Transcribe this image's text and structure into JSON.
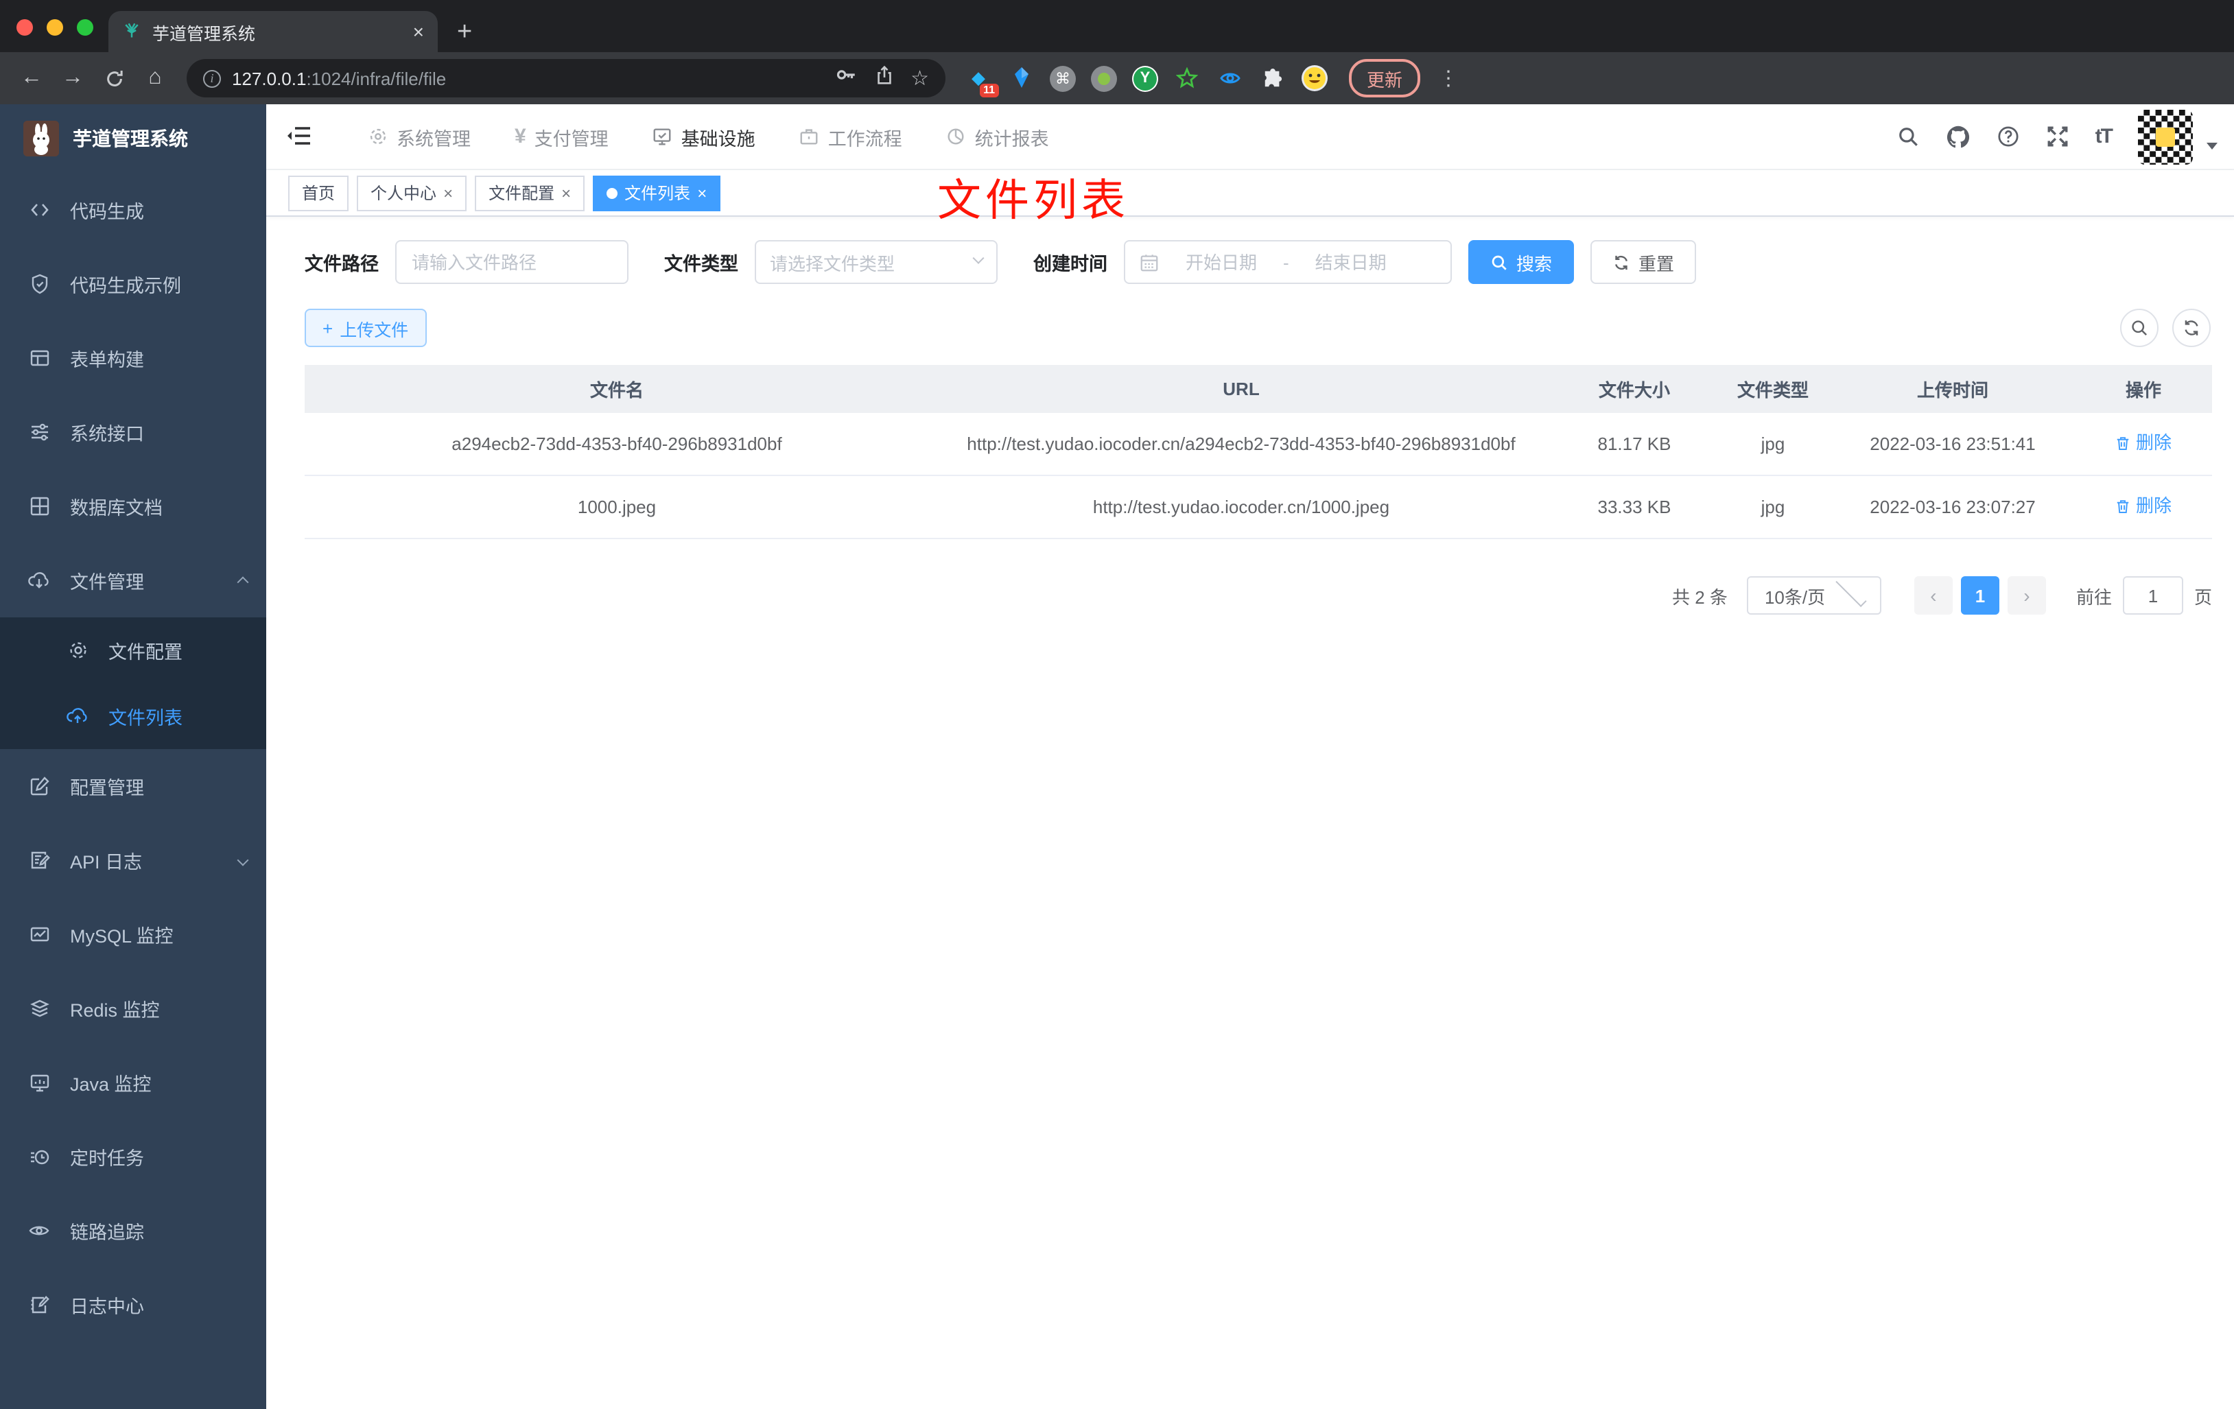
{
  "glyphs": {
    "close": "×",
    "plus": "+",
    "new_tab": "+",
    "back": "←",
    "forward": "→",
    "home": "⌂",
    "star": "☆",
    "cmd": "⌘",
    "dots": "⋮",
    "diamond": "◆",
    "prev": "‹",
    "next": "›",
    "yen": "¥",
    "font_size": "tT",
    "y_letter": "Y",
    "info": "i",
    "question": "?"
  },
  "browser": {
    "tab": {
      "title": "芋道管理系统"
    },
    "address": {
      "url_host": "127.0.0.1",
      "url_path": ":1024/infra/file/file"
    },
    "extensions": {
      "badge": "11"
    },
    "update_button": "更新"
  },
  "sidebar": {
    "title": "芋道管理系统",
    "items": [
      {
        "label": "代码生成"
      },
      {
        "label": "代码生成示例"
      },
      {
        "label": "表单构建"
      },
      {
        "label": "系统接口"
      },
      {
        "label": "数据库文档"
      },
      {
        "label": "文件管理"
      },
      {
        "label": "配置管理"
      },
      {
        "label": "API 日志"
      },
      {
        "label": "MySQL 监控"
      },
      {
        "label": "Redis 监控"
      },
      {
        "label": "Java 监控"
      },
      {
        "label": "定时任务"
      },
      {
        "label": "链路追踪"
      },
      {
        "label": "日志中心"
      }
    ],
    "submenu": [
      {
        "label": "文件配置"
      },
      {
        "label": "文件列表"
      }
    ]
  },
  "navbar": {
    "menus": [
      {
        "label": "系统管理"
      },
      {
        "label": "支付管理"
      },
      {
        "label": "基础设施"
      },
      {
        "label": "工作流程"
      },
      {
        "label": "统计报表"
      }
    ]
  },
  "tags": [
    {
      "label": "首页"
    },
    {
      "label": "个人中心"
    },
    {
      "label": "文件配置"
    },
    {
      "label": "文件列表"
    }
  ],
  "annotation": "文件列表",
  "filters": {
    "path_label": "文件路径",
    "path_placeholder": "请输入文件路径",
    "type_label": "文件类型",
    "type_placeholder": "请选择文件类型",
    "time_label": "创建时间",
    "start_placeholder": "开始日期",
    "separator": "-",
    "end_placeholder": "结束日期",
    "search": "搜索",
    "reset": "重置"
  },
  "toolbar": {
    "upload": "上传文件"
  },
  "table": {
    "headers": [
      "文件名",
      "URL",
      "文件大小",
      "文件类型",
      "上传时间",
      "操作"
    ],
    "rows": [
      {
        "name": "a294ecb2-73dd-4353-bf40-296b8931d0bf",
        "url": "http://test.yudao.iocoder.cn/a294ecb2-73dd-4353-bf40-296b8931d0bf",
        "size": "81.17 KB",
        "type": "jpg",
        "time": "2022-03-16 23:51:41",
        "action": "删除"
      },
      {
        "name": "1000.jpeg",
        "url": "http://test.yudao.iocoder.cn/1000.jpeg",
        "size": "33.33 KB",
        "type": "jpg",
        "time": "2022-03-16 23:07:27",
        "action": "删除"
      }
    ]
  },
  "pagination": {
    "total": "共 2 条",
    "page_size": "10条/页",
    "page": "1",
    "goto_label": "前往",
    "goto_value": "1",
    "page_unit": "页"
  },
  "colors": {
    "primary": "#409eff",
    "sidebar_bg": "#304156",
    "submenu_bg": "#1f2d3d",
    "annotation_red": "#fe1507",
    "tag_active": "#409eff"
  }
}
